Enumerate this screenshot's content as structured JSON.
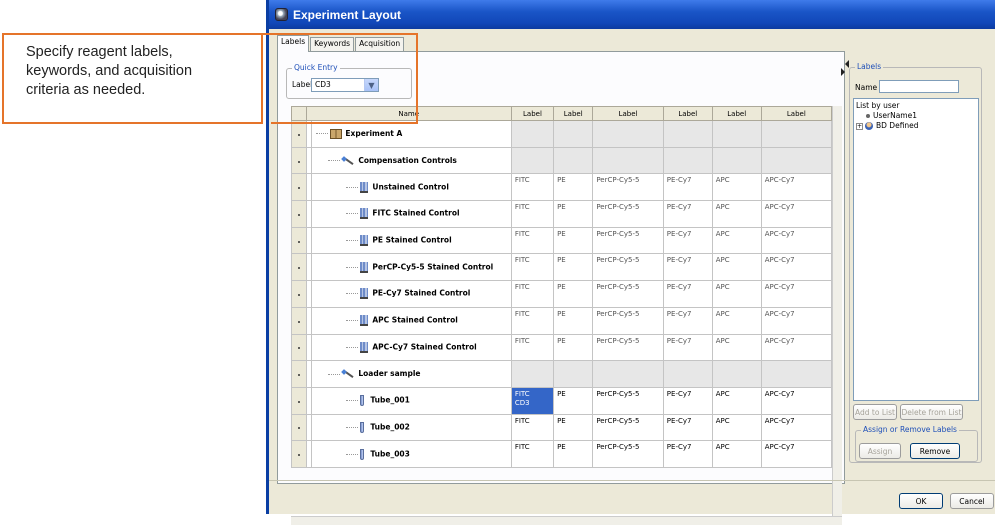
{
  "callout": {
    "lines": [
      "Specify reagent labels,",
      "keywords, and acquisition",
      "criteria as needed."
    ],
    "border_color": "#e5742a"
  },
  "window": {
    "title": "Experiment Layout",
    "accent": "#1a55c7"
  },
  "tabs": [
    "Labels",
    "Keywords",
    "Acquisition"
  ],
  "quick_entry": {
    "group_label": "Quick Entry",
    "field_label": "Label",
    "value": "CD3"
  },
  "grid": {
    "name_header": "Name",
    "label_headers": [
      "Label",
      "Label",
      "Label",
      "Label",
      "Label",
      "Label"
    ],
    "rows": [
      {
        "name": "Experiment A",
        "icon": "experiment-icon",
        "labels": [
          "",
          "",
          "",
          "",
          "",
          ""
        ]
      },
      {
        "name": "Compensation Controls",
        "icon": "wand-icon",
        "labels": [
          "",
          "",
          "",
          "",
          "",
          ""
        ]
      },
      {
        "name": "Unstained Control",
        "icon": "tubes-icon",
        "labels": [
          "FITC",
          "PE",
          "PerCP-Cy5-5",
          "PE-Cy7",
          "APC",
          "APC-Cy7"
        ]
      },
      {
        "name": "FITC Stained Control",
        "icon": "tubes-icon",
        "labels": [
          "FITC",
          "PE",
          "PerCP-Cy5-5",
          "PE-Cy7",
          "APC",
          "APC-Cy7"
        ]
      },
      {
        "name": "PE Stained Control",
        "icon": "tubes-icon",
        "labels": [
          "FITC",
          "PE",
          "PerCP-Cy5-5",
          "PE-Cy7",
          "APC",
          "APC-Cy7"
        ]
      },
      {
        "name": "PerCP-Cy5-5 Stained Control",
        "icon": "tubes-icon",
        "labels": [
          "FITC",
          "PE",
          "PerCP-Cy5-5",
          "PE-Cy7",
          "APC",
          "APC-Cy7"
        ]
      },
      {
        "name": "PE-Cy7 Stained Control",
        "icon": "tubes-icon",
        "labels": [
          "FITC",
          "PE",
          "PerCP-Cy5-5",
          "PE-Cy7",
          "APC",
          "APC-Cy7"
        ]
      },
      {
        "name": "APC Stained Control",
        "icon": "tubes-icon",
        "labels": [
          "FITC",
          "PE",
          "PerCP-Cy5-5",
          "PE-Cy7",
          "APC",
          "APC-Cy7"
        ]
      },
      {
        "name": "APC-Cy7 Stained Control",
        "icon": "tubes-icon",
        "labels": [
          "FITC",
          "PE",
          "PerCP-Cy5-5",
          "PE-Cy7",
          "APC",
          "APC-Cy7"
        ]
      },
      {
        "name": "Loader sample",
        "icon": "wand-icon",
        "labels": [
          "",
          "",
          "",
          "",
          "",
          ""
        ]
      },
      {
        "name": "Tube_001",
        "icon": "tube-icon",
        "labels": [
          "FITC",
          "PE",
          "PerCP-Cy5-5",
          "PE-Cy7",
          "APC",
          "APC-Cy7"
        ],
        "first_extra": "CD3"
      },
      {
        "name": "Tube_002",
        "icon": "tube-icon",
        "labels": [
          "FITC",
          "PE",
          "PerCP-Cy5-5",
          "PE-Cy7",
          "APC",
          "APC-Cy7"
        ]
      },
      {
        "name": "Tube_003",
        "icon": "tube-icon",
        "labels": [
          "FITC",
          "PE",
          "PerCP-Cy5-5",
          "PE-Cy7",
          "APC",
          "APC-Cy7"
        ]
      }
    ],
    "selection_color": "#3466c8"
  },
  "labels_panel": {
    "group_label": "Labels",
    "name_label": "Name",
    "name_value": "",
    "list_header": "List by user",
    "user": "UserName1",
    "bd": "BD Defined",
    "add_button": "Add to List",
    "delete_button": "Delete from List",
    "assign_group": "Assign or Remove Labels",
    "assign_button": "Assign",
    "remove_button": "Remove"
  },
  "footer": {
    "ok": "OK",
    "cancel": "Cancel"
  }
}
